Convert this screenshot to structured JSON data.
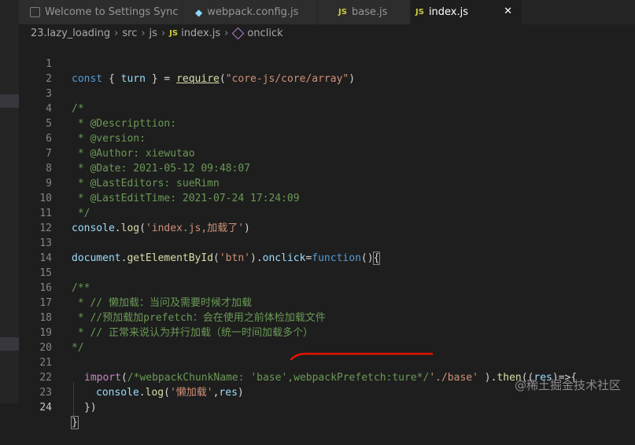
{
  "tabs": [
    {
      "label": "Welcome to Settings Sync",
      "icon": "vscode-icon"
    },
    {
      "label": "webpack.config.js",
      "icon": "webpack-icon"
    },
    {
      "label": "base.js",
      "icon": "js-icon"
    },
    {
      "label": "index.js",
      "icon": "js-icon"
    }
  ],
  "js_badge": "JS",
  "close_glyph": "✕",
  "breadcrumb": {
    "parts": [
      "23.lazy_loading",
      "src",
      "js",
      "index.js",
      "onclick"
    ],
    "separator": "›"
  },
  "line_numbers": [
    "1",
    "2",
    "3",
    "4",
    "5",
    "6",
    "7",
    "8",
    "9",
    "10",
    "11",
    "12",
    "13",
    "14",
    "15",
    "16",
    "17",
    "18",
    "19",
    "20",
    "21",
    "22",
    "23",
    "24"
  ],
  "code": {
    "l1": {
      "kw": "const",
      "a": " { ",
      "var": "turn",
      "b": " } = ",
      "fn": "require",
      "c": "(",
      "str": "\"core-js/core/array\"",
      "d": ")"
    },
    "l3": "/*",
    "l4": " * @Descripttion:",
    "l5": " * @version:",
    "l6": " * @Author: xiewutao",
    "l7": " * @Date: 2021-05-12 09:48:07",
    "l8": " * @LastEditors: sueRimn",
    "l9": " * @LastEditTime: 2021-07-24 17:24:09",
    "l10": " */",
    "l11": {
      "var": "console",
      "a": ".",
      "fn": "log",
      "b": "(",
      "str": "'index.js,加载了'",
      "c": ")"
    },
    "l13": {
      "var": "document",
      "a": ".",
      "fn": "getElementById",
      "b": "(",
      "str": "'btn'",
      "c": ").",
      "var2": "onclick",
      "d": "=",
      "kw": "function",
      "e": "()",
      "brace": "{"
    },
    "l15": "/**",
    "l16": " * // 懒加载：当问及需要时候才加载",
    "l17": " * //预加载加prefetch：会在使用之前体检加载文件",
    "l18": " * // 正常来说认为并行加载（统一时间加载多个）",
    "l19": "*/",
    "l21": {
      "ctl": "import",
      "a": "(",
      "cm": "/*webpackChunkName: 'base',webpackPrefetch:ture*/",
      "str": "'./base'",
      "b": " ).",
      "fn": "then",
      "c": "((",
      "var": "res",
      "d": ")=>{"
    },
    "l22": {
      "var": "console",
      "a": ".",
      "fn": "log",
      "b": "(",
      "str": "'懒加载'",
      "c": ",",
      "var2": "res",
      "d": ")"
    },
    "l23": "})",
    "l24": "}"
  },
  "watermark": "@稀土掘金技术社区",
  "colors": {
    "annotation_underline": "#e51400"
  }
}
